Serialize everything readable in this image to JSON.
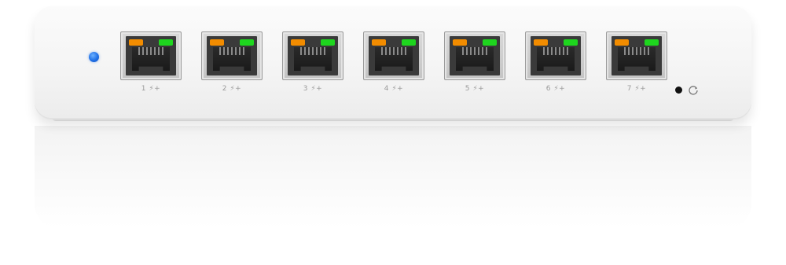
{
  "device": {
    "power_led_color": "#1f6fe6",
    "ports": [
      {
        "label": "1"
      },
      {
        "label": "2"
      },
      {
        "label": "3"
      },
      {
        "label": "4"
      },
      {
        "label": "5"
      },
      {
        "label": "6"
      },
      {
        "label": "7"
      }
    ],
    "port_label_suffix": "⚡+",
    "link_led_color": "#f28c00",
    "activity_led_color": "#1ed61e",
    "reset_icon": "reset-icon"
  }
}
